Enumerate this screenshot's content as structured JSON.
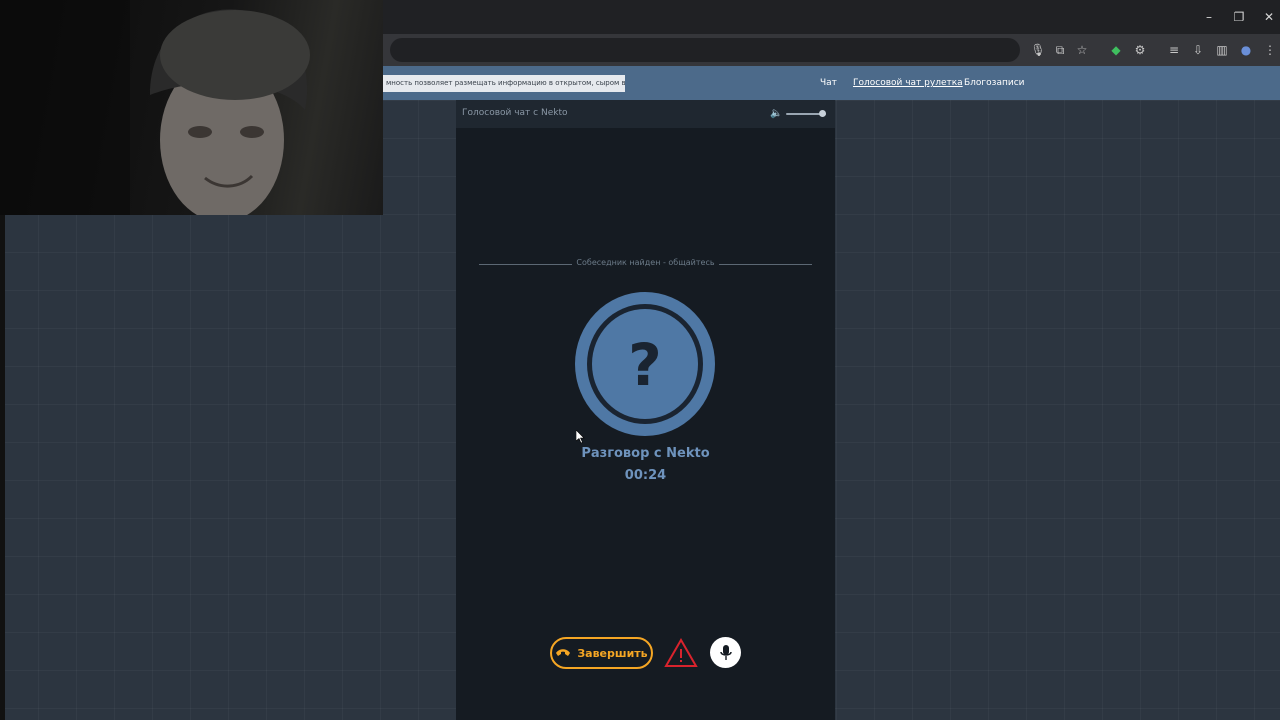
{
  "browser": {
    "notice_text": "мность позволяет размещать информацию в открытом, сыром виде!"
  },
  "nav": {
    "links": [
      "Чат",
      "Голосовой чат рулетка",
      "Блогозаписи"
    ],
    "active_index": 1
  },
  "panel": {
    "title": "Голосовой чат с Nekto",
    "volume_level": 0.9,
    "status_text": "Собеседник найден - общайтесь",
    "avatar_symbol": "?",
    "call_title": "Разговор с Nekto",
    "timer": "00:24",
    "end_button_label": "Завершить"
  },
  "icons": {
    "volume": "volume-icon",
    "phone": "phone-hangup-icon",
    "warning": "warning-icon",
    "mic": "microphone-icon"
  },
  "colors": {
    "accent": "#6e93bd",
    "end_button": "#f5a624",
    "warning": "#d9232d",
    "navbar": "#4c6a8a",
    "panel_bg": "#151b22"
  }
}
